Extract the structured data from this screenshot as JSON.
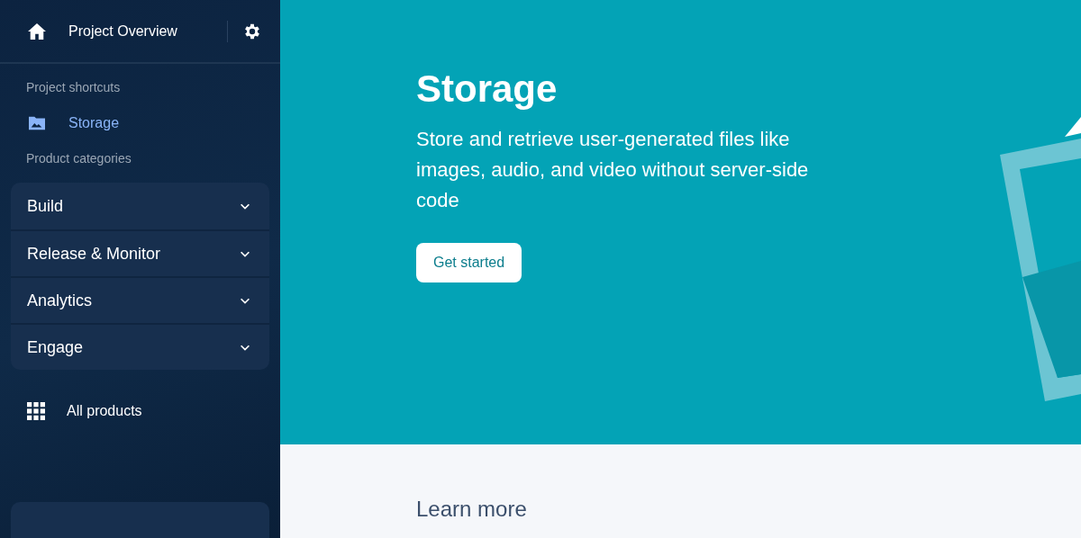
{
  "sidebar": {
    "header": {
      "title": "Project Overview"
    },
    "shortcuts_label": "Project shortcuts",
    "shortcuts": [
      {
        "label": "Storage",
        "selected": true
      }
    ],
    "categories_label": "Product categories",
    "categories": [
      {
        "label": "Build",
        "expanded": false
      },
      {
        "label": "Release & Monitor",
        "expanded": false
      },
      {
        "label": "Analytics",
        "expanded": false
      },
      {
        "label": "Engage",
        "expanded": false
      }
    ],
    "all_products": "All products"
  },
  "hero": {
    "title": "Storage",
    "description": "Store and retrieve user-generated files like images, audio, and video without server-side code",
    "button": "Get started"
  },
  "section": {
    "title": "Learn more"
  }
}
